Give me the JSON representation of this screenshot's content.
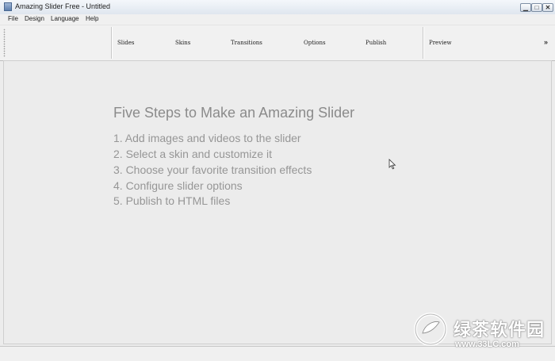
{
  "window": {
    "title": "Amazing Slider Free - Untitled",
    "controls": {
      "minimize": "▁",
      "maximize": "□",
      "close": "✕"
    }
  },
  "menu": [
    "File",
    "Design",
    "Language",
    "Help"
  ],
  "toolbar": {
    "tabs": [
      "Slides",
      "Skins",
      "Transitions",
      "Options",
      "Publish",
      "Preview"
    ],
    "overflow": "»"
  },
  "main": {
    "heading": "Five Steps to Make an Amazing Slider",
    "steps": [
      "1. Add images and videos to the slider",
      "2. Select a skin and customize it",
      "3. Choose your favorite transition effects",
      "4. Configure slider options",
      "5. Publish to HTML files"
    ]
  },
  "watermark": {
    "text": "绿茶软件园",
    "url": "www.33LC.com"
  },
  "icons": {
    "app": "app-icon",
    "grip": "toolbar-grip-icon",
    "cursor": "mouse-cursor-icon",
    "watermark": "green-tea-logo-icon"
  }
}
